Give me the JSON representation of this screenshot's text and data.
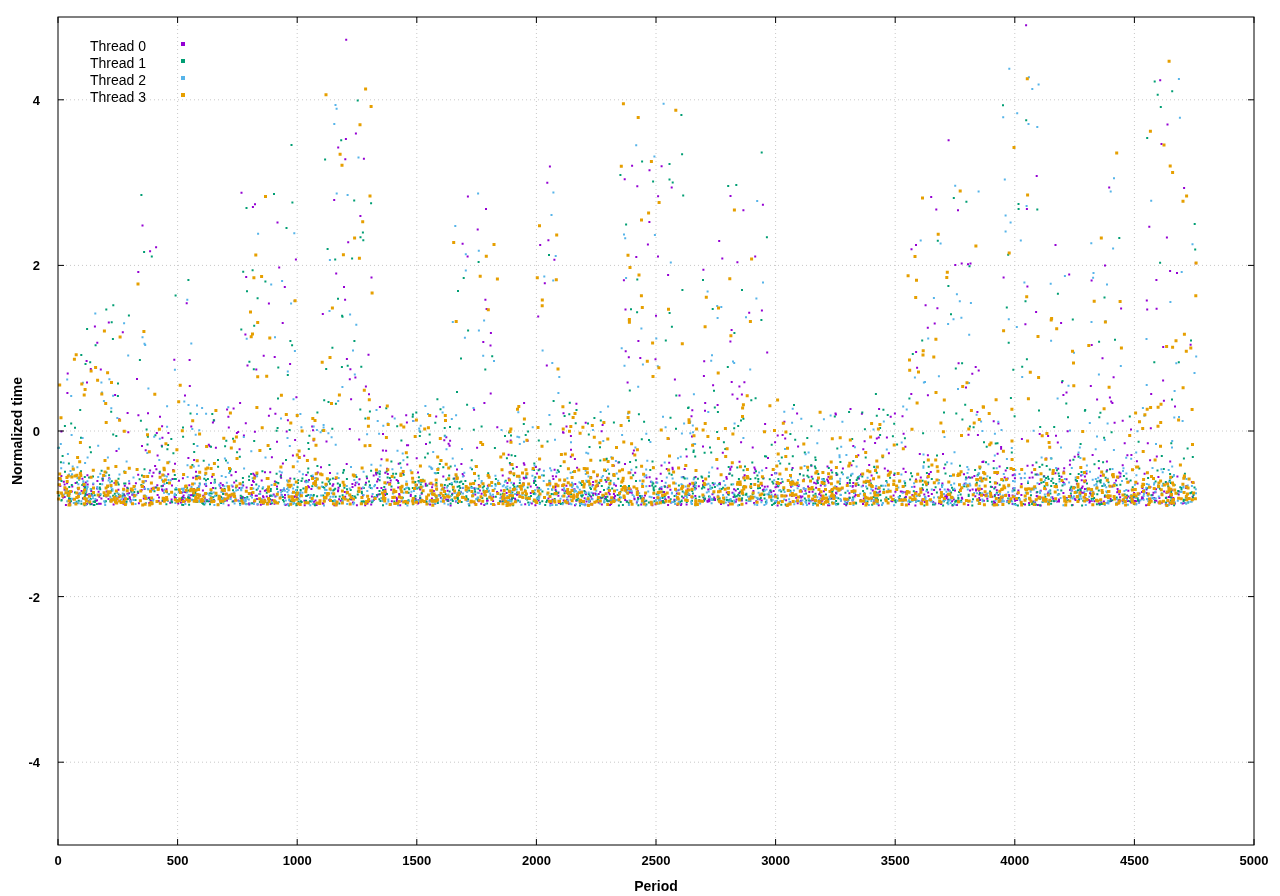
{
  "plot": {
    "x_axis": {
      "title": "Period",
      "ticks": [
        "0",
        "500",
        "1000",
        "1500",
        "2000",
        "2500",
        "3000",
        "3500",
        "4000",
        "4500",
        "5000"
      ]
    },
    "y_axis": {
      "title": "Normalized time",
      "ticks": [
        "4",
        "2",
        "0",
        "-2",
        "-4"
      ]
    },
    "legend": [
      {
        "label": "Thread 0",
        "color": "#9400d3"
      },
      {
        "label": "Thread 1",
        "color": "#009e73"
      },
      {
        "label": "Thread 2",
        "color": "#56b4e9"
      },
      {
        "label": "Thread 3",
        "color": "#e69f00"
      }
    ]
  }
}
